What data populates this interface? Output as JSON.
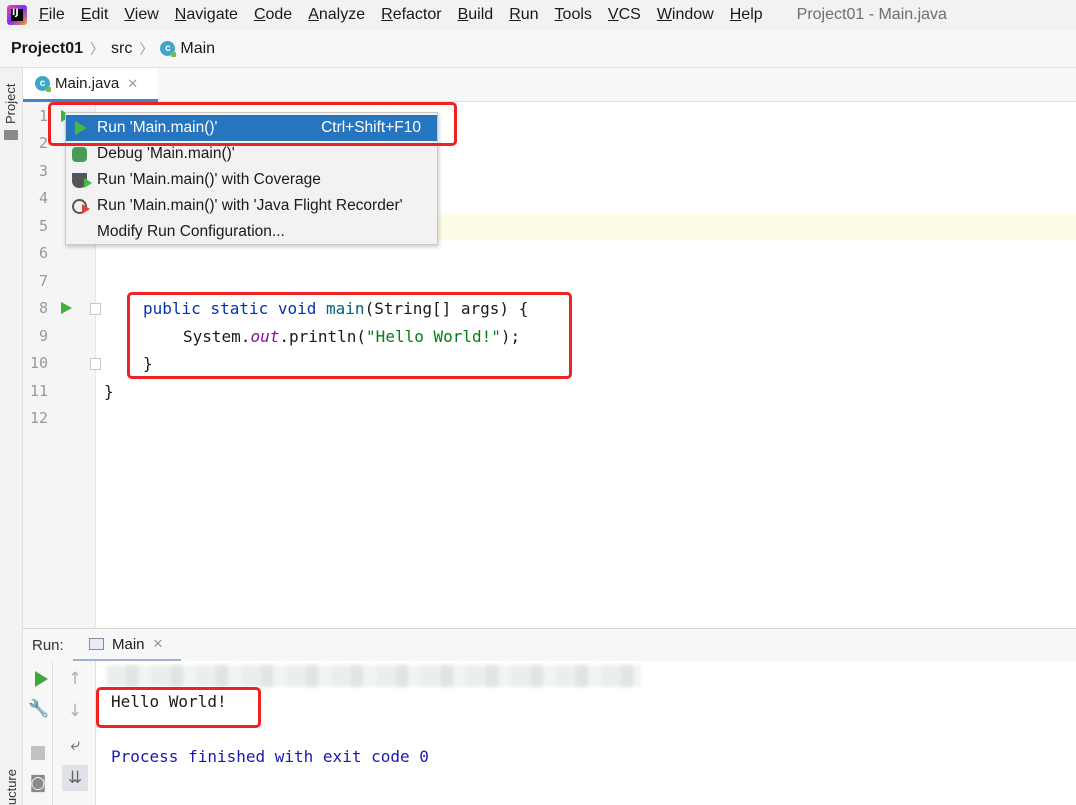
{
  "menubar": {
    "items": [
      "File",
      "Edit",
      "View",
      "Navigate",
      "Code",
      "Analyze",
      "Refactor",
      "Build",
      "Run",
      "Tools",
      "VCS",
      "Window",
      "Help"
    ],
    "window_title": "Project01 - Main.java"
  },
  "breadcrumb": {
    "project": "Project01",
    "folder": "src",
    "file": "Main"
  },
  "left_strip": {
    "project_tab": "Project",
    "structure_tab": "ucture"
  },
  "editor": {
    "tab_label": "Main.java",
    "line_numbers": [
      "1",
      "2",
      "3",
      "4",
      "5",
      "6",
      "7",
      "8",
      "9",
      "10",
      "11",
      "12"
    ],
    "code": {
      "line8_kw": "public static void ",
      "line8_fn": "main",
      "line8_rest": "(String[] args) {",
      "line9_a": "System.",
      "line9_field": "out",
      "line9_b": ".println(",
      "line9_str": "\"Hello World!\"",
      "line9_c": ");",
      "line10": "}",
      "line11": "}"
    }
  },
  "popup": {
    "items": [
      {
        "label": "Run 'Main.main()'",
        "shortcut": "Ctrl+Shift+F10",
        "icon": "run-icon"
      },
      {
        "label": "Debug 'Main.main()'",
        "shortcut": "",
        "icon": "debug-icon"
      },
      {
        "label": "Run 'Main.main()' with Coverage",
        "shortcut": "",
        "icon": "coverage-icon"
      },
      {
        "label": "Run 'Main.main()' with 'Java Flight Recorder'",
        "shortcut": "",
        "icon": "flight-recorder-icon"
      },
      {
        "label": "Modify Run Configuration...",
        "shortcut": "",
        "icon": ""
      }
    ]
  },
  "run_panel": {
    "label": "Run:",
    "tab_label": "Main",
    "output": "Hello World!",
    "exit_message": "Process finished with exit code 0"
  },
  "colors": {
    "highlight": "#ee2222",
    "selection": "#2675bf",
    "keyword": "#0033b3",
    "string": "#067d17"
  }
}
